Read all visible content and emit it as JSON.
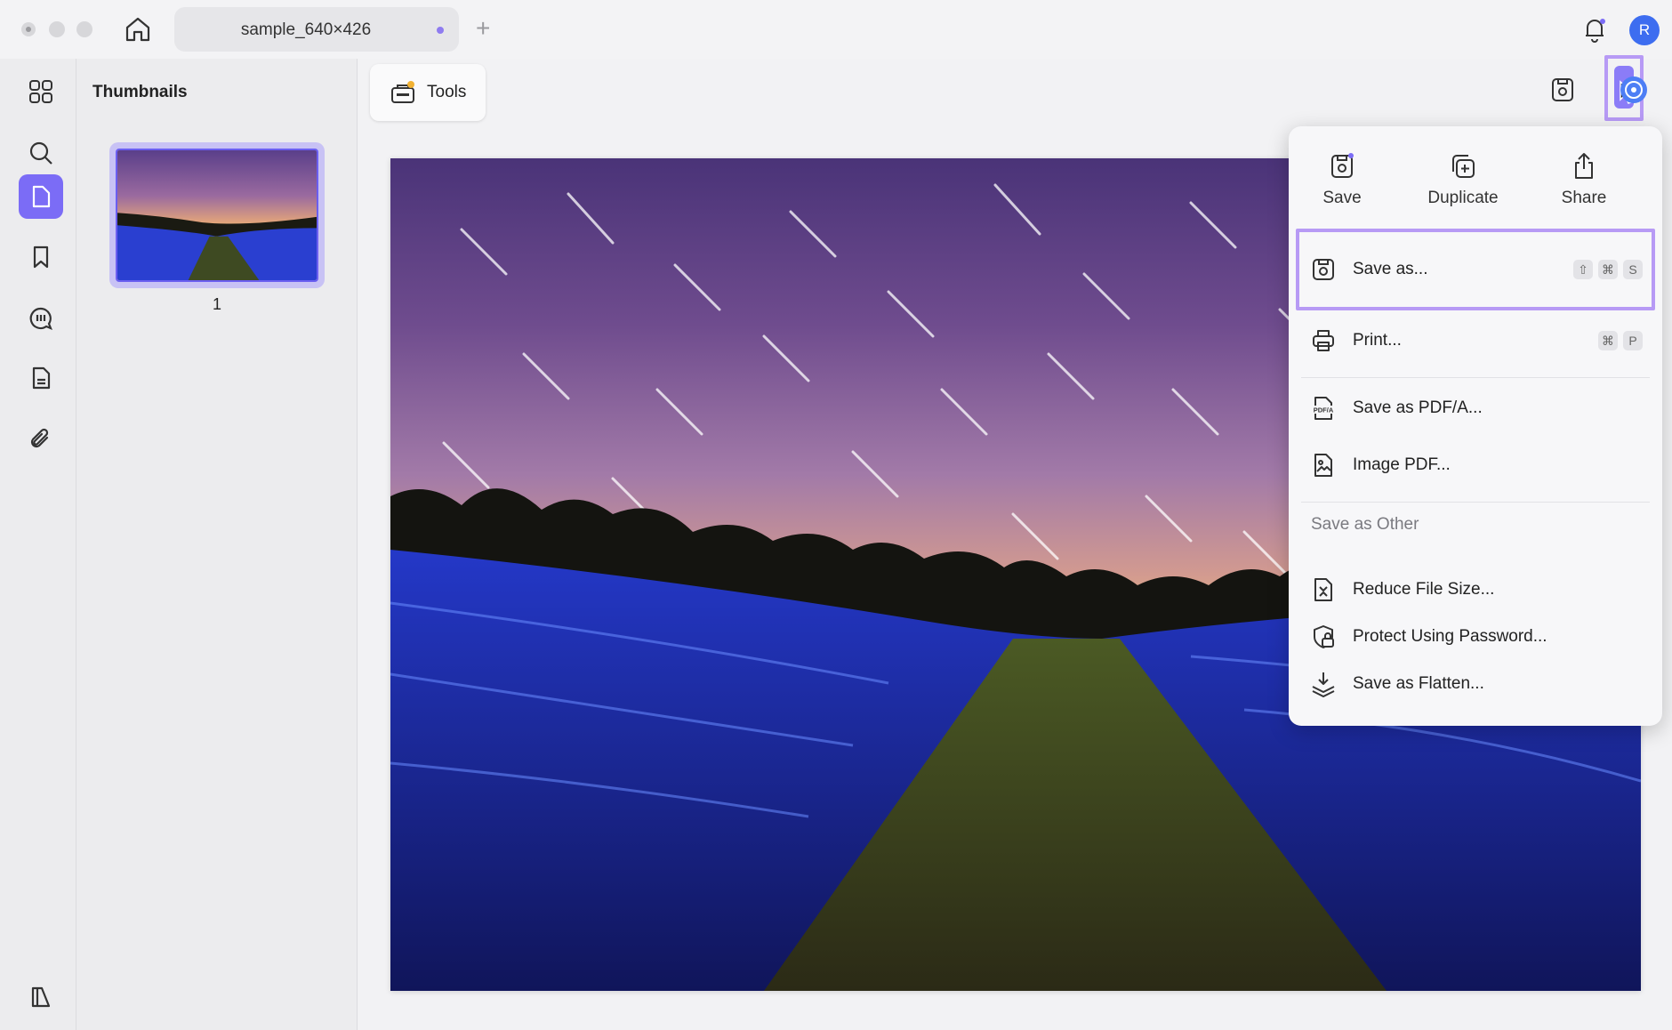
{
  "window": {
    "tab_title": "sample_640×426",
    "new_tab_symbol": "+",
    "user_initial": "R"
  },
  "sidebar": {
    "panel_title": "Thumbnails",
    "icons": [
      "grid-icon",
      "search-icon",
      "page-icon",
      "bookmark-icon",
      "comment-icon",
      "form-icon",
      "attachment-icon"
    ],
    "active": "page-icon",
    "bottom_icon": "sidebar-toggle-icon"
  },
  "thumbnails": [
    {
      "page_number": "1"
    }
  ],
  "toolbar": {
    "tools_label": "Tools"
  },
  "menu": {
    "top_actions": [
      {
        "label": "Save",
        "icon": "save-icon"
      },
      {
        "label": "Duplicate",
        "icon": "duplicate-icon"
      },
      {
        "label": "Share",
        "icon": "share-icon"
      }
    ],
    "items": [
      {
        "label": "Save as...",
        "icon": "save-as-icon",
        "shortcut": [
          "⇧",
          "⌘",
          "S"
        ]
      },
      {
        "label": "Print...",
        "icon": "print-icon",
        "shortcut": [
          "⌘",
          "P"
        ]
      },
      {
        "label": "Save as PDF/A...",
        "icon": "pdfa-icon"
      },
      {
        "label": "Image PDF...",
        "icon": "image-pdf-icon"
      }
    ],
    "section_title": "Save as Other",
    "other_items": [
      {
        "label": "Reduce File Size...",
        "icon": "reduce-size-icon"
      },
      {
        "label": "Protect Using Password...",
        "icon": "password-icon"
      },
      {
        "label": "Save as Flatten...",
        "icon": "flatten-icon"
      }
    ],
    "pdfa_badge": "PDF/A"
  },
  "colors": {
    "accent": "#7b6cf6",
    "highlight_border": "#b79af5",
    "avatar": "#3d6df0"
  }
}
